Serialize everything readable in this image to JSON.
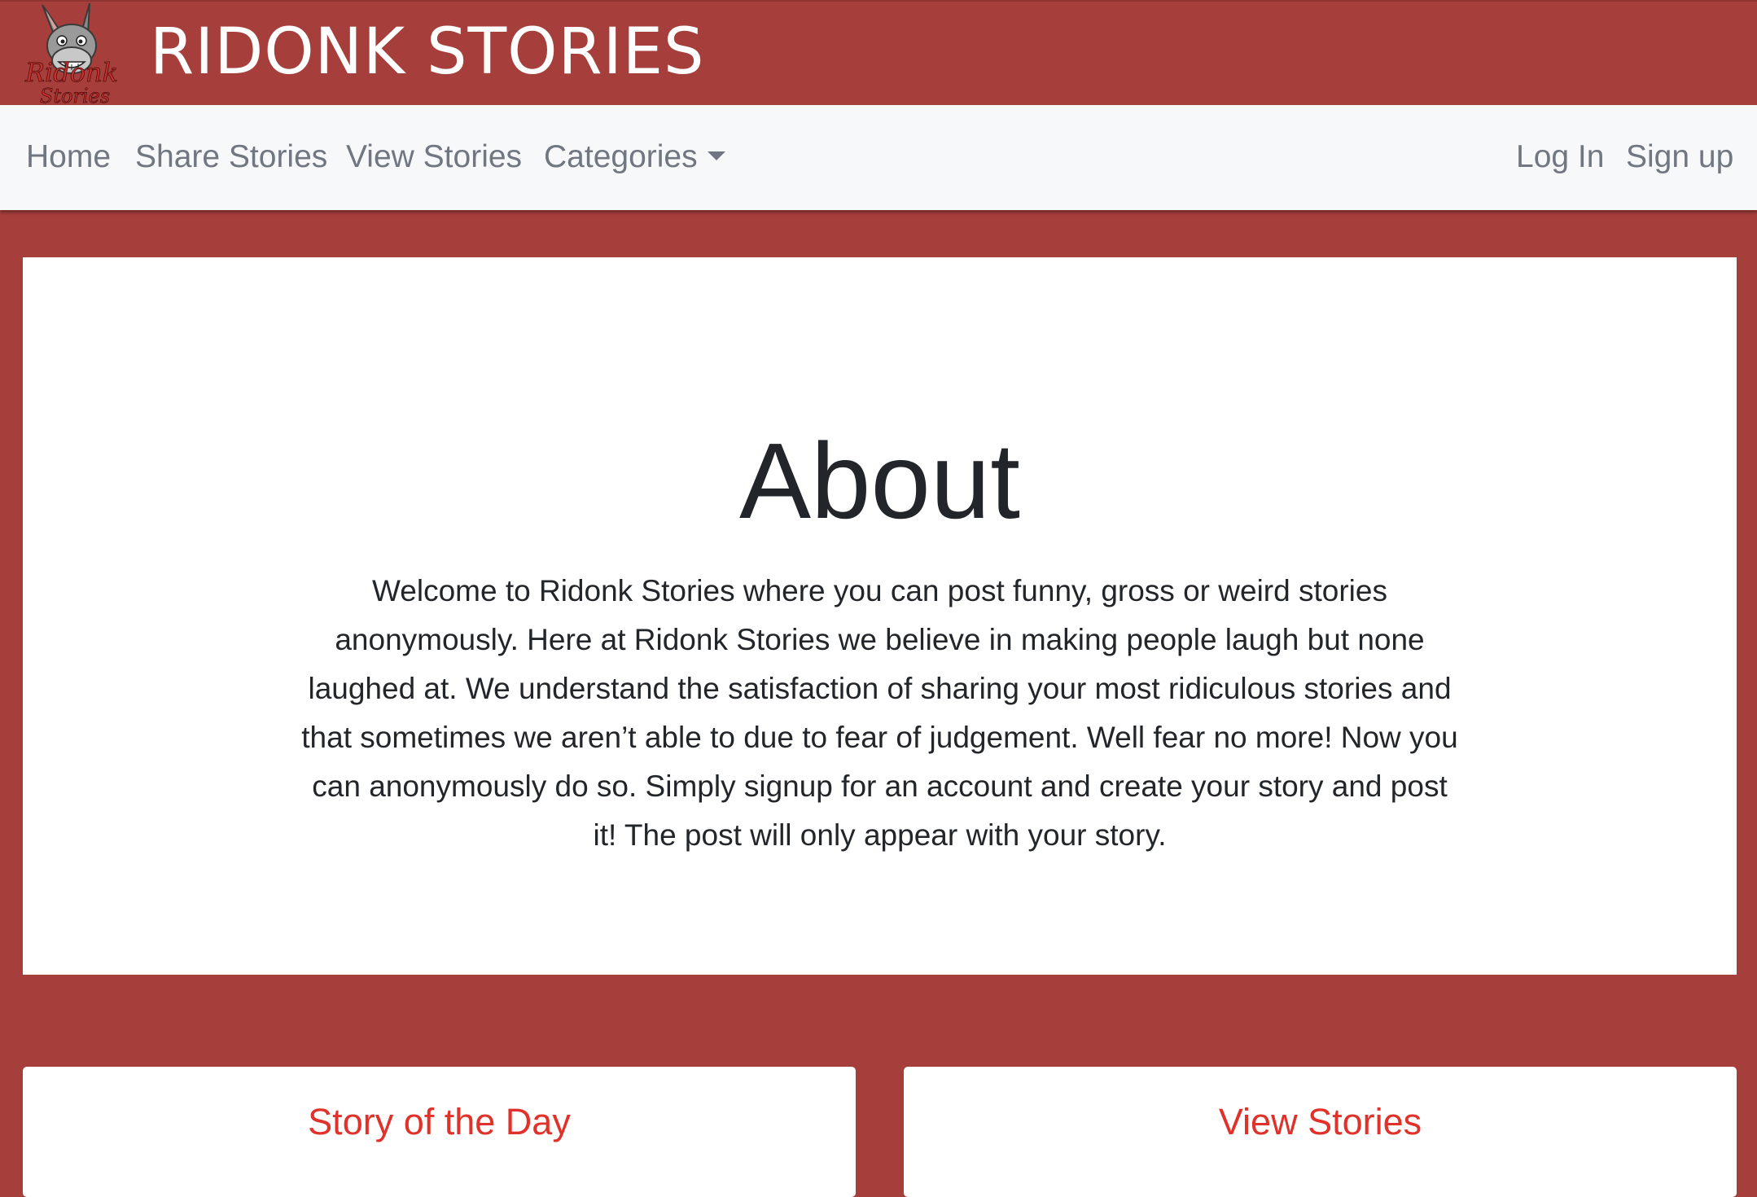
{
  "header": {
    "logo_text": "Ridonk Stories",
    "title": "RIDONK STORIES"
  },
  "nav": {
    "home": "Home",
    "share": "Share Stories",
    "view": "View Stories",
    "categories": "Categories",
    "login": "Log In",
    "signup": "Sign up"
  },
  "about": {
    "title": "About",
    "body": "Welcome to Ridonk Stories where you can post funny, gross or weird stories anonymously. Here at Ridonk Stories we believe in making people laugh but none laughed at. We understand the satisfaction of sharing your most ridiculous stories and that sometimes we aren’t able to due to fear of judgement. Well fear no more! Now you can anonymously do so. Simply signup for an account and create your story and post it! The post will only appear with your story."
  },
  "cards": {
    "story_of_day": "Story of the Day",
    "view_stories": "View Stories"
  },
  "colors": {
    "brand_red": "#a63f3c",
    "accent_red": "#e0312a",
    "nav_bg": "#f7f8fa",
    "nav_text": "#707780"
  }
}
